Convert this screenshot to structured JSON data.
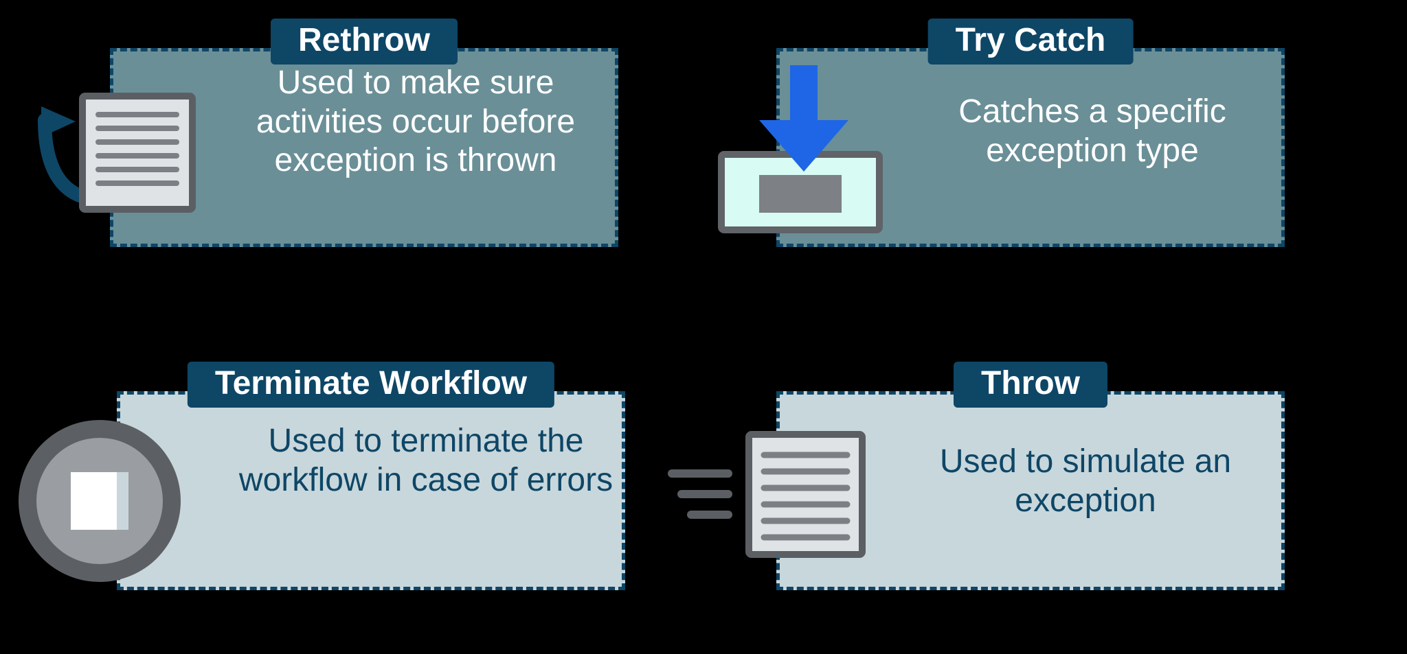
{
  "cards": {
    "rethrow": {
      "title": "Rethrow",
      "body": "Used to make sure activities occur before exception is thrown"
    },
    "trycatch": {
      "title": "Try Catch",
      "body": "Catches a specific exception type"
    },
    "terminate": {
      "title": "Terminate Workflow",
      "body": "Used to terminate the workflow in case of errors"
    },
    "throw": {
      "title": "Throw",
      "body": "Used to simulate an exception"
    }
  },
  "colors": {
    "navy": "#0e4666",
    "teal": "#6a8f97",
    "light": "#c8d7dc",
    "blue_arrow": "#1e66e6"
  }
}
